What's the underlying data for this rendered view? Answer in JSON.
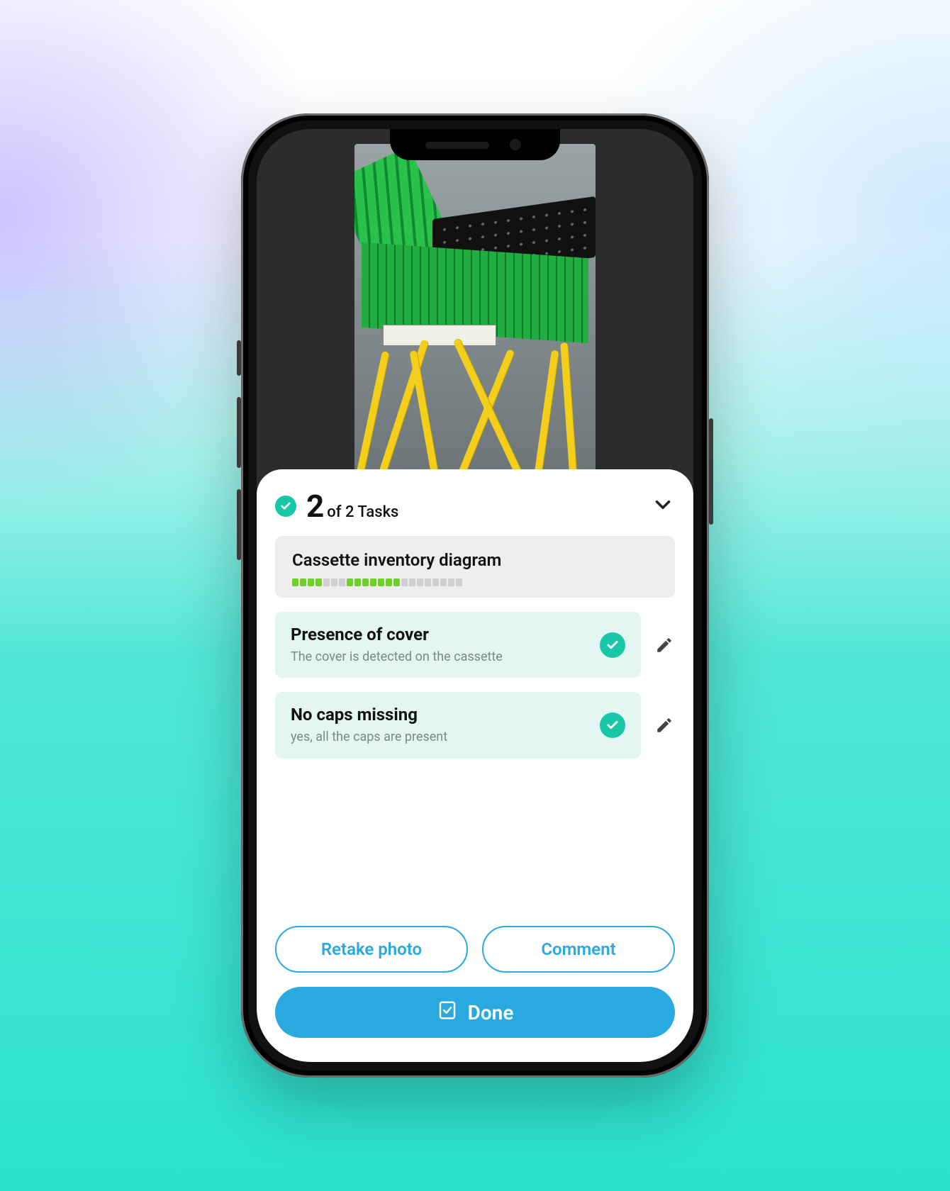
{
  "colors": {
    "accent": "#17c7a7",
    "primary": "#2aa9e0"
  },
  "tasks": {
    "completed": "2",
    "total_label": "of 2 Tasks"
  },
  "progress_card": {
    "title": "Cassette inventory diagram",
    "segments_total": 22,
    "segments_pattern": [
      1,
      1,
      1,
      1,
      0,
      0,
      0,
      1,
      1,
      1,
      1,
      1,
      1,
      1,
      0,
      0,
      0,
      0,
      0,
      0,
      0,
      0
    ]
  },
  "checks": [
    {
      "title": "Presence of cover",
      "description": "The cover is detected on the cassette",
      "status": "pass"
    },
    {
      "title": "No caps missing",
      "description": "yes, all the caps are present",
      "status": "pass"
    }
  ],
  "buttons": {
    "retake": "Retake photo",
    "comment": "Comment",
    "done": "Done"
  },
  "icons": {
    "check": "check-icon",
    "chevron_down": "chevron-down-icon",
    "pencil": "pencil-icon",
    "done_clipboard": "clipboard-check-icon"
  }
}
